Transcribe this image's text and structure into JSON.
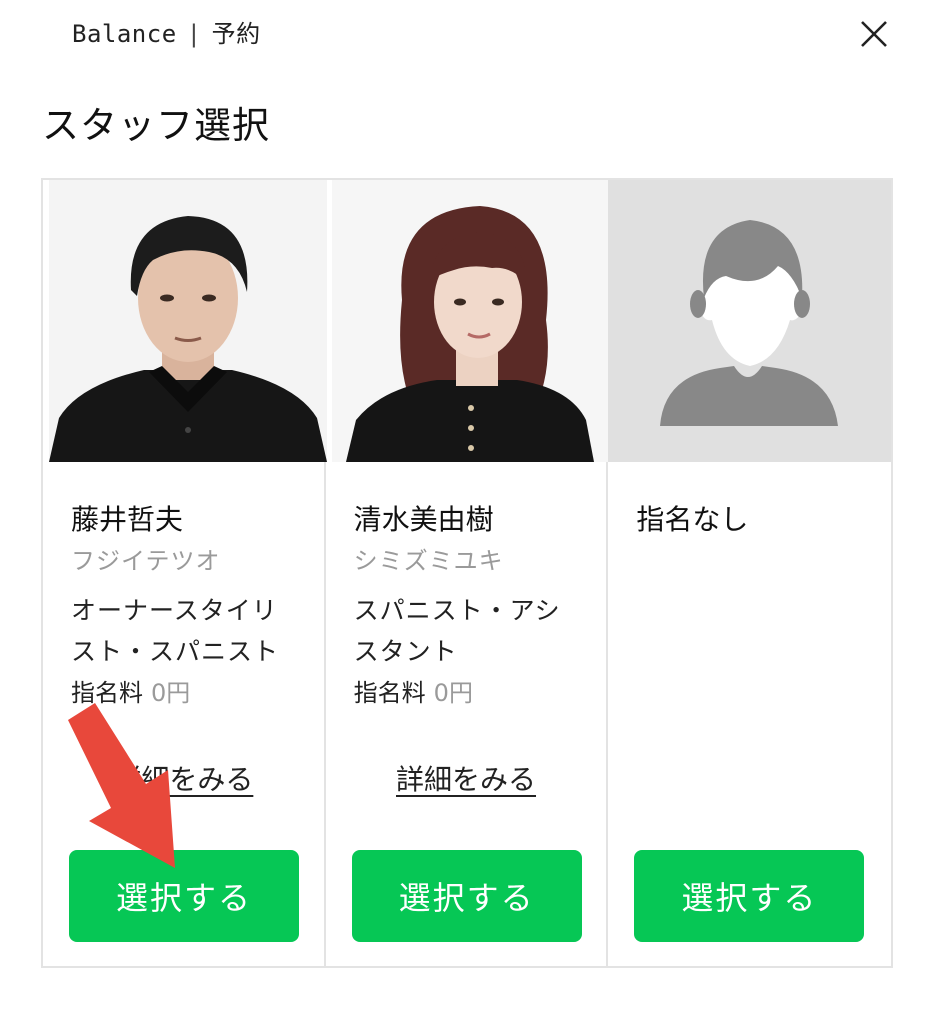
{
  "header": {
    "brand": "Balance",
    "separator": "|",
    "section": "予約"
  },
  "page_title": "スタッフ選択",
  "staff": [
    {
      "name": "藤井哲夫",
      "kana": "フジイテツオ",
      "role": "オーナースタイリスト・スパニスト",
      "fee_label": "指名料",
      "fee_value": "0円",
      "details_label": "詳細をみる",
      "select_label": "選択する"
    },
    {
      "name": "清水美由樹",
      "kana": "シミズミユキ",
      "role": "スパニスト・アシスタント",
      "fee_label": "指名料",
      "fee_value": "0円",
      "details_label": "詳細をみる",
      "select_label": "選択する"
    },
    {
      "name": "指名なし",
      "select_label": "選択する"
    }
  ],
  "colors": {
    "accent": "#06c755",
    "annotation_arrow": "#e8483b"
  },
  "icons": [
    "close-icon",
    "person-placeholder-icon",
    "annotation-arrow"
  ]
}
